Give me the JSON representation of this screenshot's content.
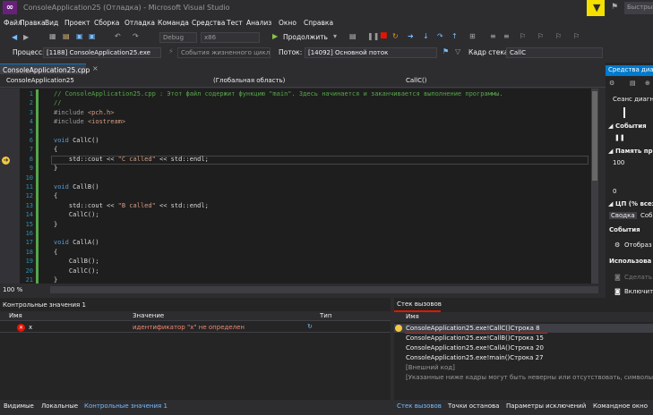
{
  "window": {
    "title": "ConsoleApplication25 (Отладка) - Microsoft Visual Studio",
    "quick_launch": "Быстрый"
  },
  "menu": [
    "Файл",
    "Правка",
    "Вид",
    "Проект",
    "Сборка",
    "Отладка",
    "Команда",
    "Средства",
    "Тест",
    "Анализ",
    "Окно",
    "Справка"
  ],
  "toolbar": {
    "config": "Debug",
    "platform": "x86",
    "continue": "Продолжить"
  },
  "debugbar": {
    "process_label": "Процесс:",
    "process": "[1188] ConsoleApplication25.exe",
    "lifecycle": "События жизненного цикла",
    "thread_label": "Поток:",
    "thread": "[14092] Основной поток",
    "frame_label": "Кадр стека:",
    "frame": "CallC"
  },
  "editor": {
    "tab": "ConsoleApplication25.cpp",
    "tab_close": "×",
    "nav_project": "ConsoleApplication25",
    "nav_scope": "(Глобальная область)",
    "nav_func": "CallC()",
    "zoom": "100 %",
    "lines": [
      {
        "n": "1",
        "parts": [
          {
            "c": "cm",
            "t": "// ConsoleApplication25.cpp : Этот файл содержит функцию \"main\". Здесь начинается и заканчивается выполнение программы."
          }
        ]
      },
      {
        "n": "2",
        "parts": [
          {
            "c": "cm",
            "t": "//"
          }
        ]
      },
      {
        "n": "3",
        "parts": [
          {
            "c": "pp",
            "t": "#include "
          },
          {
            "c": "st",
            "t": "<pch.h>"
          }
        ]
      },
      {
        "n": "4",
        "parts": [
          {
            "c": "pp",
            "t": "#include "
          },
          {
            "c": "st",
            "t": "<iostream>"
          }
        ]
      },
      {
        "n": "5",
        "parts": []
      },
      {
        "n": "6",
        "parts": [
          {
            "c": "kw",
            "t": "void "
          },
          {
            "c": "",
            "t": "CallC()"
          }
        ]
      },
      {
        "n": "7",
        "parts": [
          {
            "c": "",
            "t": "{"
          }
        ]
      },
      {
        "n": "8",
        "parts": [
          {
            "c": "",
            "t": "    std::cout << "
          },
          {
            "c": "st",
            "t": "\"C called\""
          },
          {
            "c": "",
            "t": " << std::endl;"
          }
        ]
      },
      {
        "n": "9",
        "parts": [
          {
            "c": "",
            "t": "}"
          }
        ]
      },
      {
        "n": "10",
        "parts": []
      },
      {
        "n": "11",
        "parts": [
          {
            "c": "kw",
            "t": "void "
          },
          {
            "c": "",
            "t": "CallB()"
          }
        ]
      },
      {
        "n": "12",
        "parts": [
          {
            "c": "",
            "t": "{"
          }
        ]
      },
      {
        "n": "13",
        "parts": [
          {
            "c": "",
            "t": "    std::cout << "
          },
          {
            "c": "st",
            "t": "\"B called\""
          },
          {
            "c": "",
            "t": " << std::endl;"
          }
        ]
      },
      {
        "n": "14",
        "parts": [
          {
            "c": "",
            "t": "    CallC();"
          }
        ]
      },
      {
        "n": "15",
        "parts": [
          {
            "c": "",
            "t": "}"
          }
        ]
      },
      {
        "n": "16",
        "parts": []
      },
      {
        "n": "17",
        "parts": [
          {
            "c": "kw",
            "t": "void "
          },
          {
            "c": "",
            "t": "CallA()"
          }
        ]
      },
      {
        "n": "18",
        "parts": [
          {
            "c": "",
            "t": "{"
          }
        ]
      },
      {
        "n": "19",
        "parts": [
          {
            "c": "",
            "t": "    CallB();"
          }
        ]
      },
      {
        "n": "20",
        "parts": [
          {
            "c": "",
            "t": "    CallC();"
          }
        ]
      },
      {
        "n": "21",
        "parts": [
          {
            "c": "",
            "t": "}"
          }
        ]
      }
    ]
  },
  "diagnostics": {
    "header": "Средства диаг",
    "session": "Сеанс диагн",
    "events": "События",
    "memory": "Память про",
    "mem_val": "100",
    "mem_zero": "0",
    "cpu": "ЦП (% всех",
    "tab_summary": "Сводка",
    "tab_events": "События",
    "events2": "События",
    "display": "Отобраз",
    "usage": "Использова",
    "make": "Сделать",
    "enable": "Включит"
  },
  "watch": {
    "header": "Контрольные значения 1",
    "col_name": "Имя",
    "col_value": "Значение",
    "col_type": "Тип",
    "row_name": "x",
    "row_value": "идентификатор \"x\" не определен"
  },
  "bottom_tabs_left": [
    "Видимые",
    "Локальные",
    "Контрольные значения 1"
  ],
  "bottom_tabs_right": [
    "Стек вызовов",
    "Точки останова",
    "Параметры исключений",
    "Командное окно"
  ],
  "callstack": {
    "header": "Стек вызовов",
    "col_name": "Имя",
    "rows": [
      "ConsoleApplication25.exe!CallC()Строка 8",
      "ConsoleApplication25.exe!CallB()Строка 15",
      "ConsoleApplication25.exe!CallA()Строка 20",
      "ConsoleApplication25.exe!main()Строка 27",
      "[Внешний код]",
      "[Указанные ниже кадры могут быть неверны или отсутствовать, символы д"
    ]
  }
}
